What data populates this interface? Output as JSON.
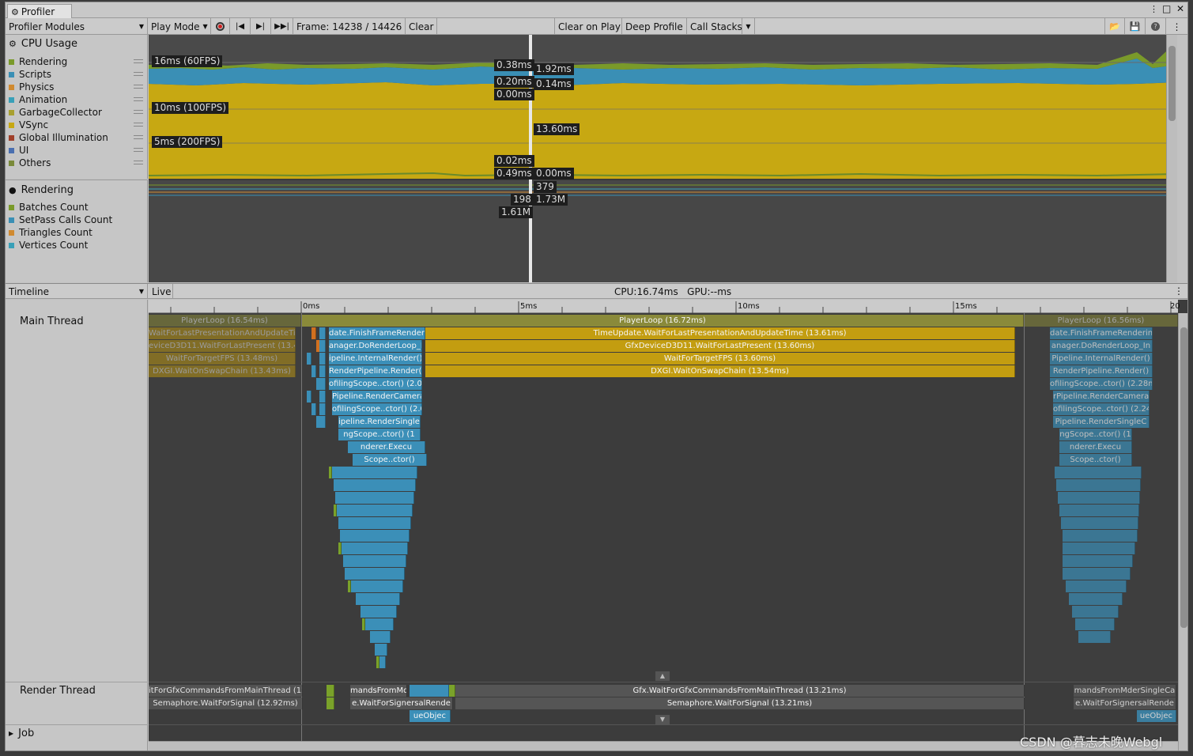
{
  "window": {
    "tab_title": "Profiler"
  },
  "toolbar": {
    "modules_label": "Profiler Modules",
    "play_mode": "Play Mode",
    "frame_text": "Frame: 14238 / 14426",
    "clear": "Clear",
    "clear_on_play": "Clear on Play",
    "deep_profile": "Deep Profile",
    "call_stacks": "Call Stacks"
  },
  "cpu_module": {
    "title": "CPU Usage",
    "legend": [
      {
        "label": "Rendering",
        "color": "#7a9a2a"
      },
      {
        "label": "Scripts",
        "color": "#3a8fb5"
      },
      {
        "label": "Physics",
        "color": "#d08a30"
      },
      {
        "label": "Animation",
        "color": "#39a0b8"
      },
      {
        "label": "GarbageCollector",
        "color": "#a8a030"
      },
      {
        "label": "VSync",
        "color": "#c7a812"
      },
      {
        "label": "Global Illumination",
        "color": "#a0402a"
      },
      {
        "label": "UI",
        "color": "#4a6fb0"
      },
      {
        "label": "Others",
        "color": "#7a8a3a"
      }
    ],
    "grid_labels": [
      "16ms (60FPS)",
      "10ms (100FPS)",
      "5ms (200FPS)"
    ],
    "values_left": [
      "0.38ms",
      "0.20ms",
      "0.00ms",
      "0.02ms",
      "0.49ms"
    ],
    "values_right": [
      "1.92ms",
      "0.14ms",
      "13.60ms",
      "0.00ms"
    ]
  },
  "rendering_module": {
    "title": "Rendering",
    "legend": [
      {
        "label": "Batches Count",
        "color": "#7a9a2a"
      },
      {
        "label": "SetPass Calls Count",
        "color": "#3a8fb5"
      },
      {
        "label": "Triangles Count",
        "color": "#d08a30"
      },
      {
        "label": "Vertices Count",
        "color": "#39a0b8"
      }
    ],
    "values": [
      "379",
      "198",
      "1.73M",
      "1.61M"
    ]
  },
  "timeline": {
    "view_label": "Timeline",
    "live": "Live",
    "cpu_gpu": "CPU:16.74ms   GPU:--ms",
    "ruler": [
      "0ms",
      "5ms",
      "10ms",
      "15ms",
      "20"
    ],
    "main_thread": "Main Thread",
    "render_thread": "Render Thread",
    "job": "Job",
    "prev_frame": [
      "PlayerLoop (16.54ms)",
      "WaitForLastPresentationAndUpdateTi",
      "eviceD3D11.WaitForLastPresent (13.4",
      "WaitForTargetFPS (13.48ms)",
      "DXGI.WaitOnSwapChain (13.43ms)"
    ],
    "current_frame": [
      "PlayerLoop (16.72ms)",
      "TimeUpdate.WaitForLastPresentationAndUpdateTime (13.61ms)",
      "GfxDeviceD3D11.WaitForLastPresent (13.60ms)",
      "WaitForTargetFPS (13.60ms)",
      "DXGI.WaitOnSwapChain (13.54ms)"
    ],
    "render_stack": [
      "date.FinishFrameRenderi",
      "anager.DoRenderLoop_I",
      "ipeline.InternalRender()",
      "RenderPipeline.Render(",
      "ofilingScope..ctor() (2.09r",
      "Pipeline.RenderCamera",
      "ofilingScope..ctor() (2.05r",
      "ipeline.RenderSingle(",
      "ngScope..ctor() (1",
      "nderer.Execu",
      "Scope..ctor()"
    ],
    "next_frame": [
      "PlayerLoop (16.56ms)",
      "date.FinishFrameRenderin",
      "anager.DoRenderLoop_In",
      "Pipeline.InternalRender()",
      "RenderPipeline.Render()",
      "ofilingScope..ctor() (2.28m",
      "rPipeline.RenderCamera",
      "ofilingScope..ctor() (2.24m",
      "Pipeline.RenderSingleC",
      "ngScope..ctor() (1",
      "nderer.Execu",
      "Scope..ctor()"
    ],
    "render_thread_bars": [
      "itForGfxCommandsFromMainThread (12",
      "Semaphore.WaitForSignal (12.92ms)",
      "mandsFromMderSingleCa",
      "e.WaitForSignersalRende",
      "ueObjec",
      "Gfx.WaitForGfxCommandsFromMainThread (13.21ms)",
      "Semaphore.WaitForSignal (13.21ms)",
      "mandsFromMderSingleCa",
      "e.WaitForSignersalRende",
      "ueObjec"
    ]
  },
  "watermark": "CSDN @暮志未晚Webgl"
}
